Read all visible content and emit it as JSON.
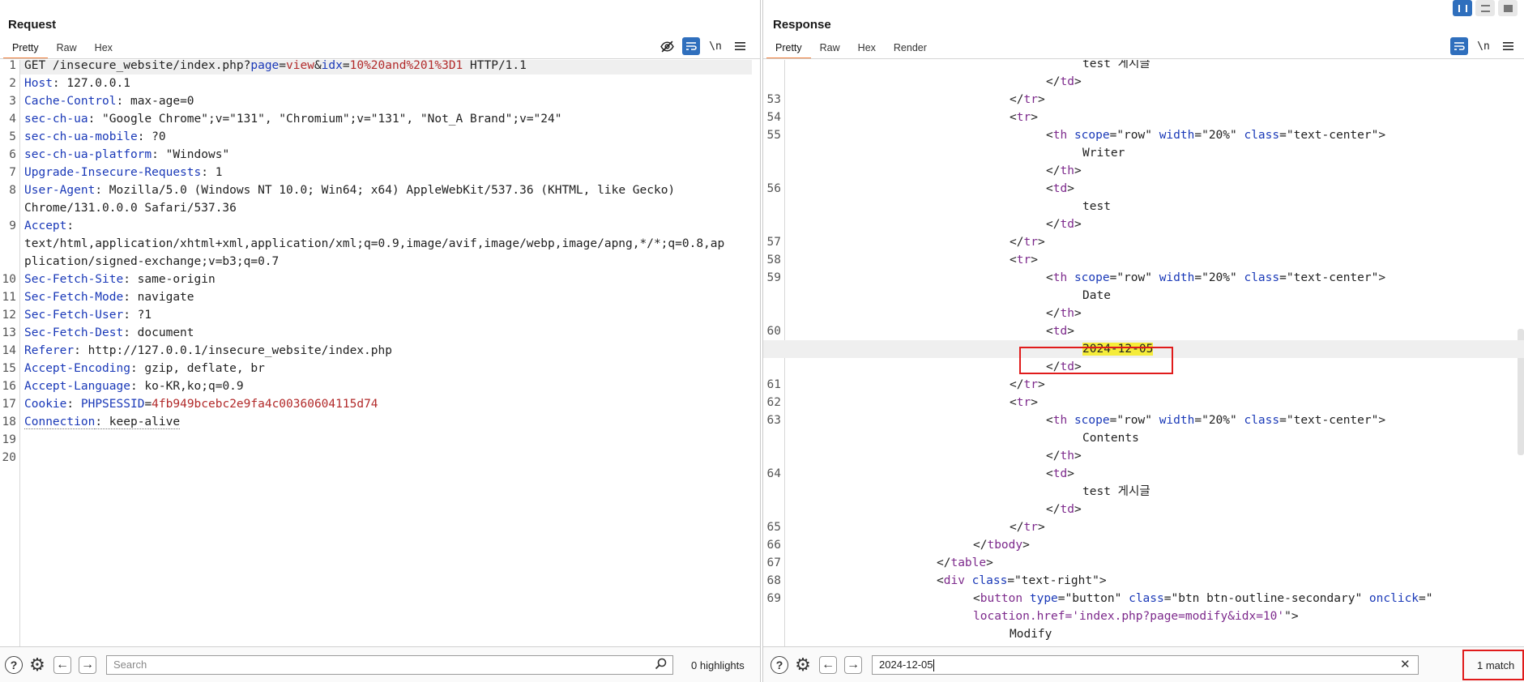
{
  "request": {
    "title": "Request",
    "tabs": [
      "Pretty",
      "Raw",
      "Hex"
    ],
    "active_tab": "Pretty",
    "toolbar_icons": [
      "eye-slash-icon",
      "wrap-icon",
      "newline-icon",
      "menu-icon"
    ],
    "newline_label": "\\n",
    "lines": [
      [
        {
          "t": "GET /insecure_website/index.php?"
        },
        {
          "t": "page",
          "c": "k"
        },
        {
          "t": "="
        },
        {
          "t": "view",
          "c": "v"
        },
        {
          "t": "&"
        },
        {
          "t": "idx",
          "c": "k"
        },
        {
          "t": "="
        },
        {
          "t": "10%20and%201%3D1",
          "c": "v"
        },
        {
          "t": " HTTP/1.1"
        }
      ],
      [
        {
          "t": "Host",
          "c": "k"
        },
        {
          "t": ": 127.0.0.1"
        }
      ],
      [
        {
          "t": "Cache-Control",
          "c": "k"
        },
        {
          "t": ": max-age=0"
        }
      ],
      [
        {
          "t": "sec-ch-ua",
          "c": "k"
        },
        {
          "t": ": \"Google Chrome\";v=\"131\", \"Chromium\";v=\"131\", \"Not_A Brand\";v=\"24\""
        }
      ],
      [
        {
          "t": "sec-ch-ua-mobile",
          "c": "k"
        },
        {
          "t": ": ?0"
        }
      ],
      [
        {
          "t": "sec-ch-ua-platform",
          "c": "k"
        },
        {
          "t": ": \"Windows\""
        }
      ],
      [
        {
          "t": "Upgrade-Insecure-Requests",
          "c": "k"
        },
        {
          "t": ": 1"
        }
      ],
      [
        {
          "t": "User-Agent",
          "c": "k"
        },
        {
          "t": ": Mozilla/5.0 (Windows NT 10.0; Win64; x64) AppleWebKit/537.36 (KHTML, like Gecko)"
        }
      ],
      [
        {
          "t": "Chrome/131.0.0.0 Safari/537.36"
        }
      ],
      [
        {
          "t": "Accept",
          "c": "k"
        },
        {
          "t": ":"
        }
      ],
      [
        {
          "t": "text/html,application/xhtml+xml,application/xml;q=0.9,image/avif,image/webp,image/apng,*/*;q=0.8,ap"
        }
      ],
      [
        {
          "t": "plication/signed-exchange;v=b3;q=0.7"
        }
      ],
      [
        {
          "t": "Sec-Fetch-Site",
          "c": "k"
        },
        {
          "t": ": same-origin"
        }
      ],
      [
        {
          "t": "Sec-Fetch-Mode",
          "c": "k"
        },
        {
          "t": ": navigate"
        }
      ],
      [
        {
          "t": "Sec-Fetch-User",
          "c": "k"
        },
        {
          "t": ": ?1"
        }
      ],
      [
        {
          "t": "Sec-Fetch-Dest",
          "c": "k"
        },
        {
          "t": ": document"
        }
      ],
      [
        {
          "t": "Referer",
          "c": "k"
        },
        {
          "t": ": http://127.0.0.1/insecure_website/index.php"
        }
      ],
      [
        {
          "t": "Accept-Encoding",
          "c": "k"
        },
        {
          "t": ": gzip, deflate, br"
        }
      ],
      [
        {
          "t": "Accept-Language",
          "c": "k"
        },
        {
          "t": ": ko-KR,ko;q=0.9"
        }
      ],
      [
        {
          "t": "Cookie",
          "c": "k"
        },
        {
          "t": ": "
        },
        {
          "t": "PHPSESSID",
          "c": "k"
        },
        {
          "t": "="
        },
        {
          "t": "4fb949bcebc2e9fa4c00360604115d74",
          "c": "v"
        }
      ],
      [
        {
          "t": "Connection",
          "c": "k dotted"
        },
        {
          "t": ": keep-alive",
          "c": "dotted"
        }
      ],
      [],
      []
    ],
    "line_numbers": [
      "1",
      "2",
      "3",
      "4",
      "5",
      "6",
      "7",
      "8",
      "",
      "9",
      "",
      "",
      "10",
      "11",
      "12",
      "13",
      "14",
      "15",
      "16",
      "17",
      "18",
      "19",
      "20"
    ],
    "search_placeholder": "Search",
    "highlights_label": "0 highlights"
  },
  "response": {
    "title": "Response",
    "tabs": [
      "Pretty",
      "Raw",
      "Hex",
      "Render"
    ],
    "active_tab": "Pretty",
    "toolbar_icons": [
      "wrap-icon",
      "newline-icon",
      "menu-icon"
    ],
    "newline_label": "\\n",
    "lines": [
      {
        "n": "",
        "i": 8,
        "s": [
          {
            "t": "test 게시글"
          }
        ]
      },
      {
        "n": "",
        "i": 7,
        "s": [
          {
            "t": "</"
          },
          {
            "t": "td",
            "c": "tn"
          },
          {
            "t": ">"
          }
        ]
      },
      {
        "n": "53",
        "i": 6,
        "s": [
          {
            "t": "</"
          },
          {
            "t": "tr",
            "c": "tn"
          },
          {
            "t": ">"
          }
        ]
      },
      {
        "n": "54",
        "i": 6,
        "s": [
          {
            "t": "<"
          },
          {
            "t": "tr",
            "c": "tn"
          },
          {
            "t": ">"
          }
        ]
      },
      {
        "n": "55",
        "i": 7,
        "s": [
          {
            "t": "<"
          },
          {
            "t": "th",
            "c": "tn"
          },
          {
            "t": " "
          },
          {
            "t": "scope",
            "c": "an"
          },
          {
            "t": "=\"row\" "
          },
          {
            "t": "width",
            "c": "an"
          },
          {
            "t": "=\"20%\" "
          },
          {
            "t": "class",
            "c": "an"
          },
          {
            "t": "=\"text-center\">"
          }
        ]
      },
      {
        "n": "",
        "i": 8,
        "s": [
          {
            "t": "Writer"
          }
        ]
      },
      {
        "n": "",
        "i": 7,
        "s": [
          {
            "t": "</"
          },
          {
            "t": "th",
            "c": "tn"
          },
          {
            "t": ">"
          }
        ]
      },
      {
        "n": "56",
        "i": 7,
        "s": [
          {
            "t": "<"
          },
          {
            "t": "td",
            "c": "tn"
          },
          {
            "t": ">"
          }
        ]
      },
      {
        "n": "",
        "i": 8,
        "s": [
          {
            "t": "test"
          }
        ]
      },
      {
        "n": "",
        "i": 7,
        "s": [
          {
            "t": "</"
          },
          {
            "t": "td",
            "c": "tn"
          },
          {
            "t": ">"
          }
        ]
      },
      {
        "n": "57",
        "i": 6,
        "s": [
          {
            "t": "</"
          },
          {
            "t": "tr",
            "c": "tn"
          },
          {
            "t": ">"
          }
        ]
      },
      {
        "n": "58",
        "i": 6,
        "s": [
          {
            "t": "<"
          },
          {
            "t": "tr",
            "c": "tn"
          },
          {
            "t": ">"
          }
        ]
      },
      {
        "n": "59",
        "i": 7,
        "s": [
          {
            "t": "<"
          },
          {
            "t": "th",
            "c": "tn"
          },
          {
            "t": " "
          },
          {
            "t": "scope",
            "c": "an"
          },
          {
            "t": "=\"row\" "
          },
          {
            "t": "width",
            "c": "an"
          },
          {
            "t": "=\"20%\" "
          },
          {
            "t": "class",
            "c": "an"
          },
          {
            "t": "=\"text-center\">"
          }
        ]
      },
      {
        "n": "",
        "i": 8,
        "s": [
          {
            "t": "Date"
          }
        ]
      },
      {
        "n": "",
        "i": 7,
        "s": [
          {
            "t": "</"
          },
          {
            "t": "th",
            "c": "tn"
          },
          {
            "t": ">"
          }
        ]
      },
      {
        "n": "60",
        "i": 7,
        "s": [
          {
            "t": "<"
          },
          {
            "t": "td",
            "c": "tn"
          },
          {
            "t": ">"
          }
        ]
      },
      {
        "n": "",
        "i": 8,
        "hl": true,
        "s": [
          {
            "t": "2024-12-05",
            "c": "search-hit"
          }
        ]
      },
      {
        "n": "",
        "i": 7,
        "s": [
          {
            "t": "</"
          },
          {
            "t": "td",
            "c": "tn"
          },
          {
            "t": ">"
          }
        ]
      },
      {
        "n": "61",
        "i": 6,
        "s": [
          {
            "t": "</"
          },
          {
            "t": "tr",
            "c": "tn"
          },
          {
            "t": ">"
          }
        ]
      },
      {
        "n": "62",
        "i": 6,
        "s": [
          {
            "t": "<"
          },
          {
            "t": "tr",
            "c": "tn"
          },
          {
            "t": ">"
          }
        ]
      },
      {
        "n": "63",
        "i": 7,
        "s": [
          {
            "t": "<"
          },
          {
            "t": "th",
            "c": "tn"
          },
          {
            "t": " "
          },
          {
            "t": "scope",
            "c": "an"
          },
          {
            "t": "=\"row\" "
          },
          {
            "t": "width",
            "c": "an"
          },
          {
            "t": "=\"20%\" "
          },
          {
            "t": "class",
            "c": "an"
          },
          {
            "t": "=\"text-center\">"
          }
        ]
      },
      {
        "n": "",
        "i": 8,
        "s": [
          {
            "t": "Contents"
          }
        ]
      },
      {
        "n": "",
        "i": 7,
        "s": [
          {
            "t": "</"
          },
          {
            "t": "th",
            "c": "tn"
          },
          {
            "t": ">"
          }
        ]
      },
      {
        "n": "64",
        "i": 7,
        "s": [
          {
            "t": "<"
          },
          {
            "t": "td",
            "c": "tn"
          },
          {
            "t": ">"
          }
        ]
      },
      {
        "n": "",
        "i": 8,
        "s": [
          {
            "t": "test 게시글"
          }
        ]
      },
      {
        "n": "",
        "i": 7,
        "s": [
          {
            "t": "</"
          },
          {
            "t": "td",
            "c": "tn"
          },
          {
            "t": ">"
          }
        ]
      },
      {
        "n": "65",
        "i": 6,
        "s": [
          {
            "t": "</"
          },
          {
            "t": "tr",
            "c": "tn"
          },
          {
            "t": ">"
          }
        ]
      },
      {
        "n": "66",
        "i": 5,
        "s": [
          {
            "t": "</"
          },
          {
            "t": "tbody",
            "c": "tn"
          },
          {
            "t": ">"
          }
        ]
      },
      {
        "n": "67",
        "i": 4,
        "s": [
          {
            "t": "</"
          },
          {
            "t": "table",
            "c": "tn"
          },
          {
            "t": ">"
          }
        ]
      },
      {
        "n": "68",
        "i": 4,
        "s": [
          {
            "t": "<"
          },
          {
            "t": "div",
            "c": "tn"
          },
          {
            "t": " "
          },
          {
            "t": "class",
            "c": "an"
          },
          {
            "t": "=\"text-right\">"
          }
        ]
      },
      {
        "n": "69",
        "i": 5,
        "s": [
          {
            "t": "<"
          },
          {
            "t": "button",
            "c": "tn"
          },
          {
            "t": " "
          },
          {
            "t": "type",
            "c": "an"
          },
          {
            "t": "=\"button\" "
          },
          {
            "t": "class",
            "c": "an"
          },
          {
            "t": "=\"btn btn-outline-secondary\" "
          },
          {
            "t": "onclick",
            "c": "an"
          },
          {
            "t": "=\""
          }
        ]
      },
      {
        "n": "",
        "i": 5,
        "s": [
          {
            "t": "location.href='index.php?page=modify&idx=10'",
            "c": "tn"
          },
          {
            "t": "\">"
          }
        ]
      },
      {
        "n": "",
        "i": 6,
        "s": [
          {
            "t": "Modify"
          }
        ]
      }
    ],
    "search_value": "2024-12-05",
    "match_label": "1 match"
  }
}
